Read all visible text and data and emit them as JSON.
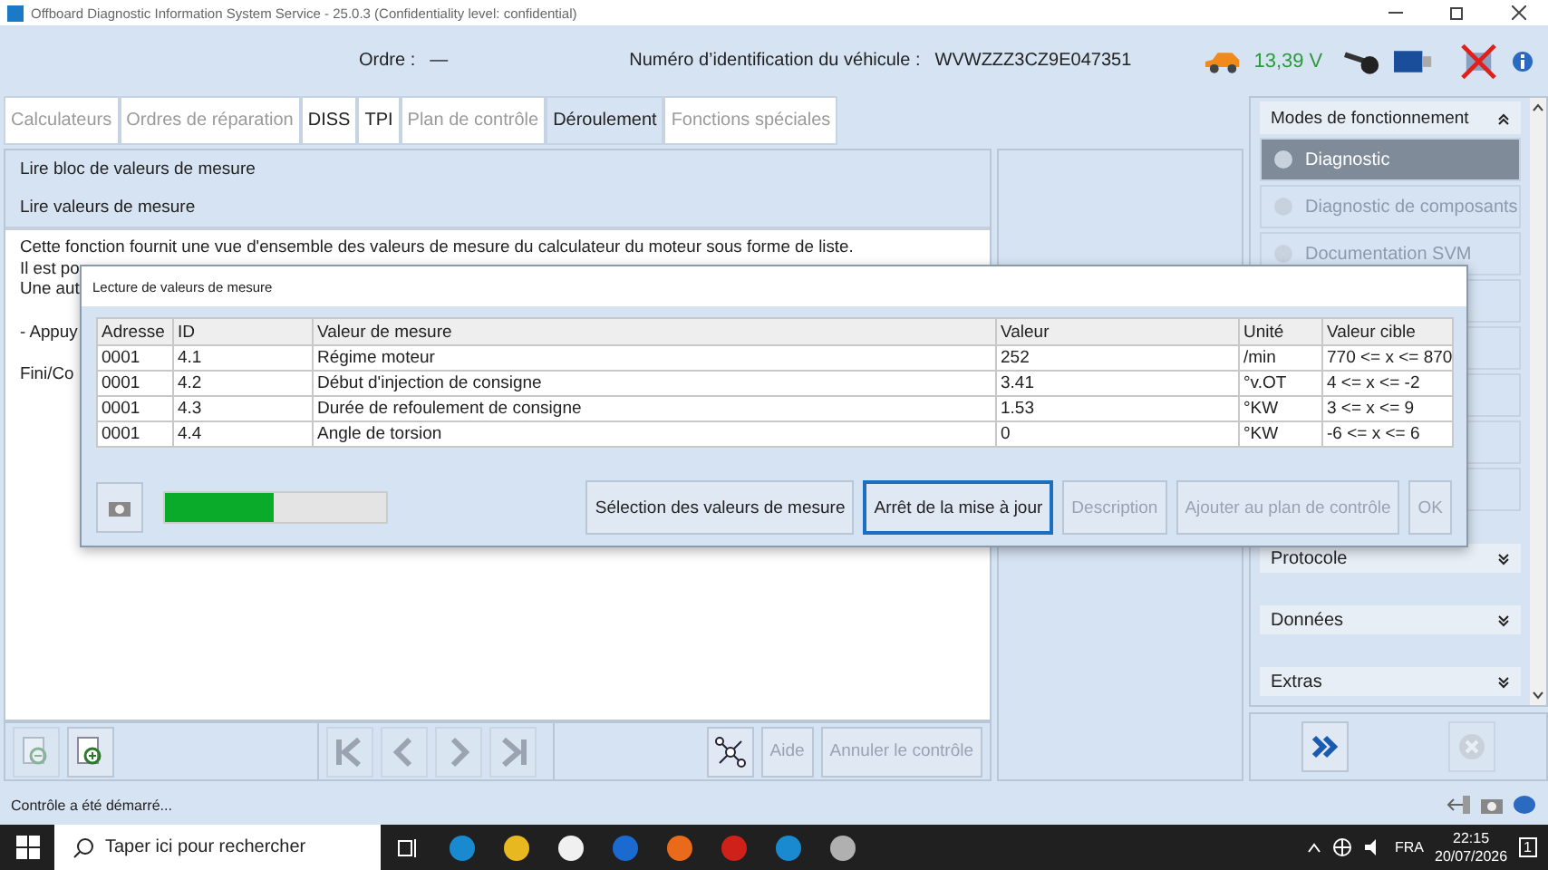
{
  "window": {
    "title": "Offboard Diagnostic Information System Service - 25.0.3 (Confidentiality level: confidential)"
  },
  "header": {
    "order_label": "Ordre :",
    "order_value": "—",
    "vin_label": "Numéro d’identification du véhicule :",
    "vin_value": "WVWZZZ3CZ9E047351",
    "voltage": "13,39 V"
  },
  "tabs": [
    {
      "label": "Calculateurs",
      "selected": false,
      "disabled": true
    },
    {
      "label": "Ordres de réparation",
      "selected": false,
      "disabled": true
    },
    {
      "label": "DISS",
      "selected": false,
      "disabled": false
    },
    {
      "label": "TPI",
      "selected": false,
      "disabled": false
    },
    {
      "label": "Plan de contrôle",
      "selected": false,
      "disabled": true
    },
    {
      "label": "Déroulement",
      "selected": true,
      "disabled": false
    },
    {
      "label": "Fonctions spéciales",
      "selected": false,
      "disabled": true
    }
  ],
  "breadcrumb": [
    "Lire bloc de valeurs de mesure",
    "Lire valeurs de mesure"
  ],
  "description": [
    [
      "Cette fonction fournit une vue d'ensemble des valeurs de mesure du calculateur du moteur sous forme de liste.",
      "Il est po",
      "Une aut"
    ],
    [
      "- Appuy"
    ],
    [
      "Fini/Co"
    ]
  ],
  "bottom_toolbar": {
    "buttons": [
      {
        "kind": "zoom-out",
        "disabled": true
      },
      {
        "kind": "zoom-in",
        "disabled": false
      }
    ],
    "nav": [
      {
        "kind": "first",
        "disabled": true
      },
      {
        "kind": "prev",
        "disabled": true
      },
      {
        "kind": "next",
        "disabled": true
      },
      {
        "kind": "last",
        "disabled": true
      }
    ],
    "network_disabled": false,
    "help": {
      "label": "Aide",
      "disabled": true
    },
    "cancel": {
      "label": "Annuler le contrôle",
      "disabled": true
    }
  },
  "sidebar": {
    "title": "Modes de fonctionnement",
    "items": [
      {
        "label": "Diagnostic",
        "selected": true,
        "disabled": true
      },
      {
        "label": "Diagnostic de composants",
        "selected": false,
        "disabled": true
      },
      {
        "label": "Documentation SVM",
        "selected": false,
        "disabled": true
      }
    ],
    "sections": [
      "Protocole",
      "Données",
      "Extras"
    ]
  },
  "dialog": {
    "title": "Lecture de valeurs de mesure",
    "table": {
      "columns": [
        "Adresse",
        "ID",
        "Valeur de mesure",
        "Valeur",
        "Unité",
        "Valeur cible"
      ],
      "rows": [
        [
          "0001",
          "4.1",
          "Régime moteur",
          "252",
          "/min",
          "770 <= x <= 870"
        ],
        [
          "0001",
          "4.2",
          "Début d'injection de consigne",
          "3.41",
          "°v.OT",
          "4 <= x <= -2"
        ],
        [
          "0001",
          "4.3",
          "Durée de refoulement de consigne",
          "1.53",
          "°KW",
          "3 <= x <= 9"
        ],
        [
          "0001",
          "4.4",
          "Angle de torsion",
          "0",
          "°KW",
          "-6 <= x <= 6"
        ]
      ]
    },
    "progress": {
      "level": 0.49
    },
    "buttons": [
      {
        "label": "Sélection des valeurs de mesure",
        "disabled": false,
        "focused": false
      },
      {
        "label": "Arrêt de la mise à jour",
        "disabled": false,
        "focused": true
      },
      {
        "label": "Description",
        "disabled": true,
        "focused": false
      },
      {
        "label": "Ajouter au plan de contrôle",
        "disabled": true,
        "focused": false
      },
      {
        "label": "OK",
        "disabled": true,
        "focused": false
      }
    ]
  },
  "status_bar": {
    "message": "Contrôle a été démarré..."
  },
  "taskbar": {
    "search_placeholder": "Taper ici pour rechercher",
    "language": "FRA",
    "time": "22:15",
    "date": "20/07/2026",
    "notifications": "1"
  }
}
